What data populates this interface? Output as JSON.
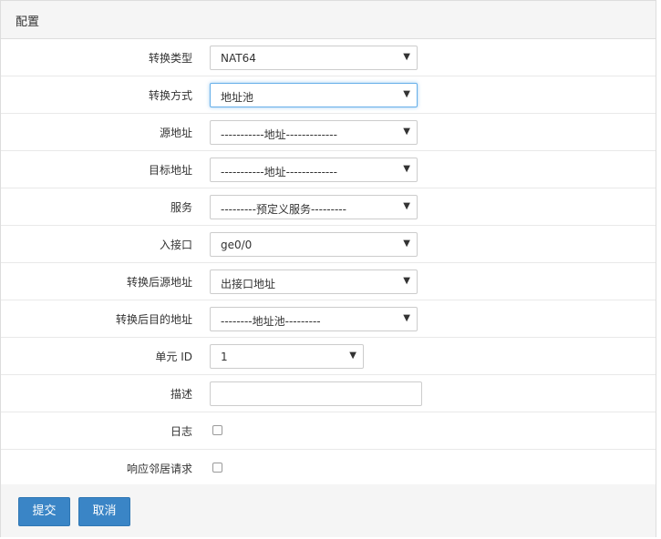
{
  "panel": {
    "title": "配置"
  },
  "form": {
    "translation_type": {
      "label": "转换类型",
      "value": "NAT64"
    },
    "translation_mode": {
      "label": "转换方式",
      "value": "地址池"
    },
    "source_address": {
      "label": "源地址",
      "value": "-----------地址-------------"
    },
    "destination_address": {
      "label": "目标地址",
      "value": "-----------地址-------------"
    },
    "service": {
      "label": "服务",
      "value": "---------预定义服务---------"
    },
    "ingress_interface": {
      "label": "入接口",
      "value": "ge0/0"
    },
    "translated_source": {
      "label": "转换后源地址",
      "value": "出接口地址"
    },
    "translated_destination": {
      "label": "转换后目的地址",
      "value": "--------地址池---------"
    },
    "unit_id": {
      "label": "单元 ID",
      "value": "1"
    },
    "description": {
      "label": "描述",
      "value": ""
    },
    "log": {
      "label": "日志",
      "checked": false
    },
    "proxy_arp": {
      "label": "响应邻居请求",
      "checked": false
    }
  },
  "footer": {
    "submit_label": "提交",
    "cancel_label": "取消"
  },
  "colors": {
    "primary_button": "#3a85c6",
    "heading_bg": "#f5f5f5",
    "focus_border": "#66afe9"
  }
}
